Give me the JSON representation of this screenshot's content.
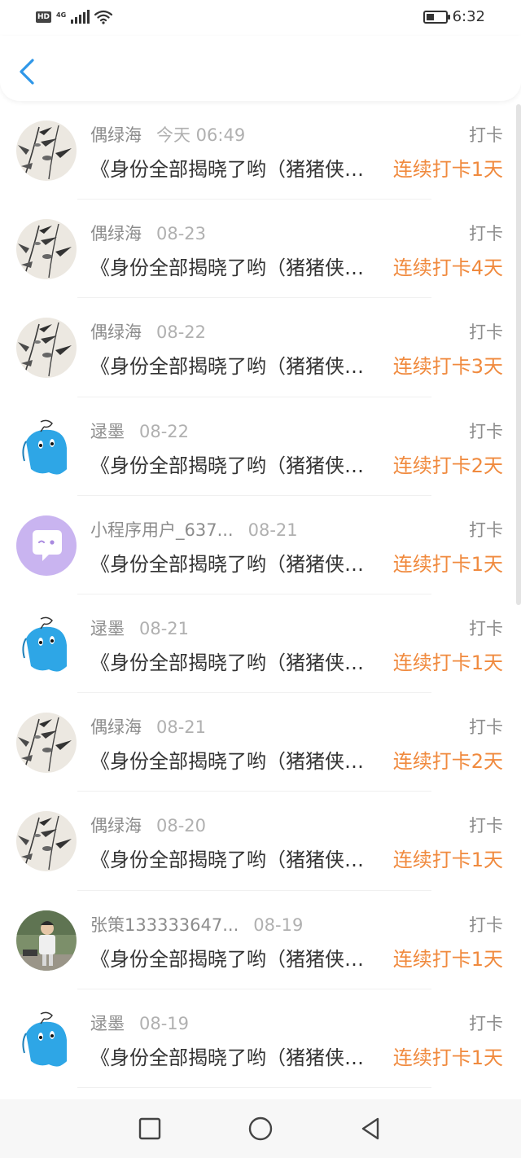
{
  "status_bar": {
    "hd_label": "HD",
    "network_label": "4G",
    "time": "6:32",
    "battery_level": 0.4
  },
  "header": {
    "back_icon": "chevron-left-icon",
    "accent_color": "#2f97e8"
  },
  "colors": {
    "streak": "#f08a3e",
    "username": "#8c8c8c",
    "timestamp": "#b0b0b0",
    "title": "#333333"
  },
  "items": [
    {
      "avatar": "bamboo-painting",
      "username": "偶绿海",
      "time": "今天 06:49",
      "type": "打卡",
      "title": "《身份全部揭晓了哟（猪猪侠大揭秘",
      "streak": "连续打卡1天"
    },
    {
      "avatar": "bamboo-painting",
      "username": "偶绿海",
      "time": "08-23",
      "type": "打卡",
      "title": "《身份全部揭晓了哟（猪猪侠大揭秘",
      "streak": "连续打卡4天"
    },
    {
      "avatar": "bamboo-painting",
      "username": "偶绿海",
      "time": "08-22",
      "type": "打卡",
      "title": "《身份全部揭晓了哟（猪猪侠大揭秘",
      "streak": "连续打卡3天"
    },
    {
      "avatar": "blue-cartoon",
      "username": "逯墨",
      "time": "08-22",
      "type": "打卡",
      "title": "《身份全部揭晓了哟（猪猪侠大揭秘",
      "streak": "连续打卡2天"
    },
    {
      "avatar": "chat-bubble",
      "username": "小程序用户_637...",
      "time": "08-21",
      "type": "打卡",
      "title": "《身份全部揭晓了哟（猪猪侠大揭秘",
      "streak": "连续打卡1天"
    },
    {
      "avatar": "blue-cartoon",
      "username": "逯墨",
      "time": "08-21",
      "type": "打卡",
      "title": "《身份全部揭晓了哟（猪猪侠大揭秘",
      "streak": "连续打卡1天"
    },
    {
      "avatar": "bamboo-painting",
      "username": "偶绿海",
      "time": "08-21",
      "type": "打卡",
      "title": "《身份全部揭晓了哟（猪猪侠大揭秘",
      "streak": "连续打卡2天"
    },
    {
      "avatar": "bamboo-painting",
      "username": "偶绿海",
      "time": "08-20",
      "type": "打卡",
      "title": "《身份全部揭晓了哟（猪猪侠大揭秘",
      "streak": "连续打卡1天"
    },
    {
      "avatar": "child-photo",
      "username": "张策133333647...",
      "time": "08-19",
      "type": "打卡",
      "title": "《身份全部揭晓了哟（猪猪侠大揭秘",
      "streak": "连续打卡1天"
    },
    {
      "avatar": "blue-cartoon",
      "username": "逯墨",
      "time": "08-19",
      "type": "打卡",
      "title": "《身份全部揭晓了哟（猪猪侠大揭秘",
      "streak": "连续打卡1天"
    }
  ],
  "nav_bar": {
    "recent_icon": "square-icon",
    "home_icon": "circle-icon",
    "back_icon": "triangle-back-icon"
  }
}
